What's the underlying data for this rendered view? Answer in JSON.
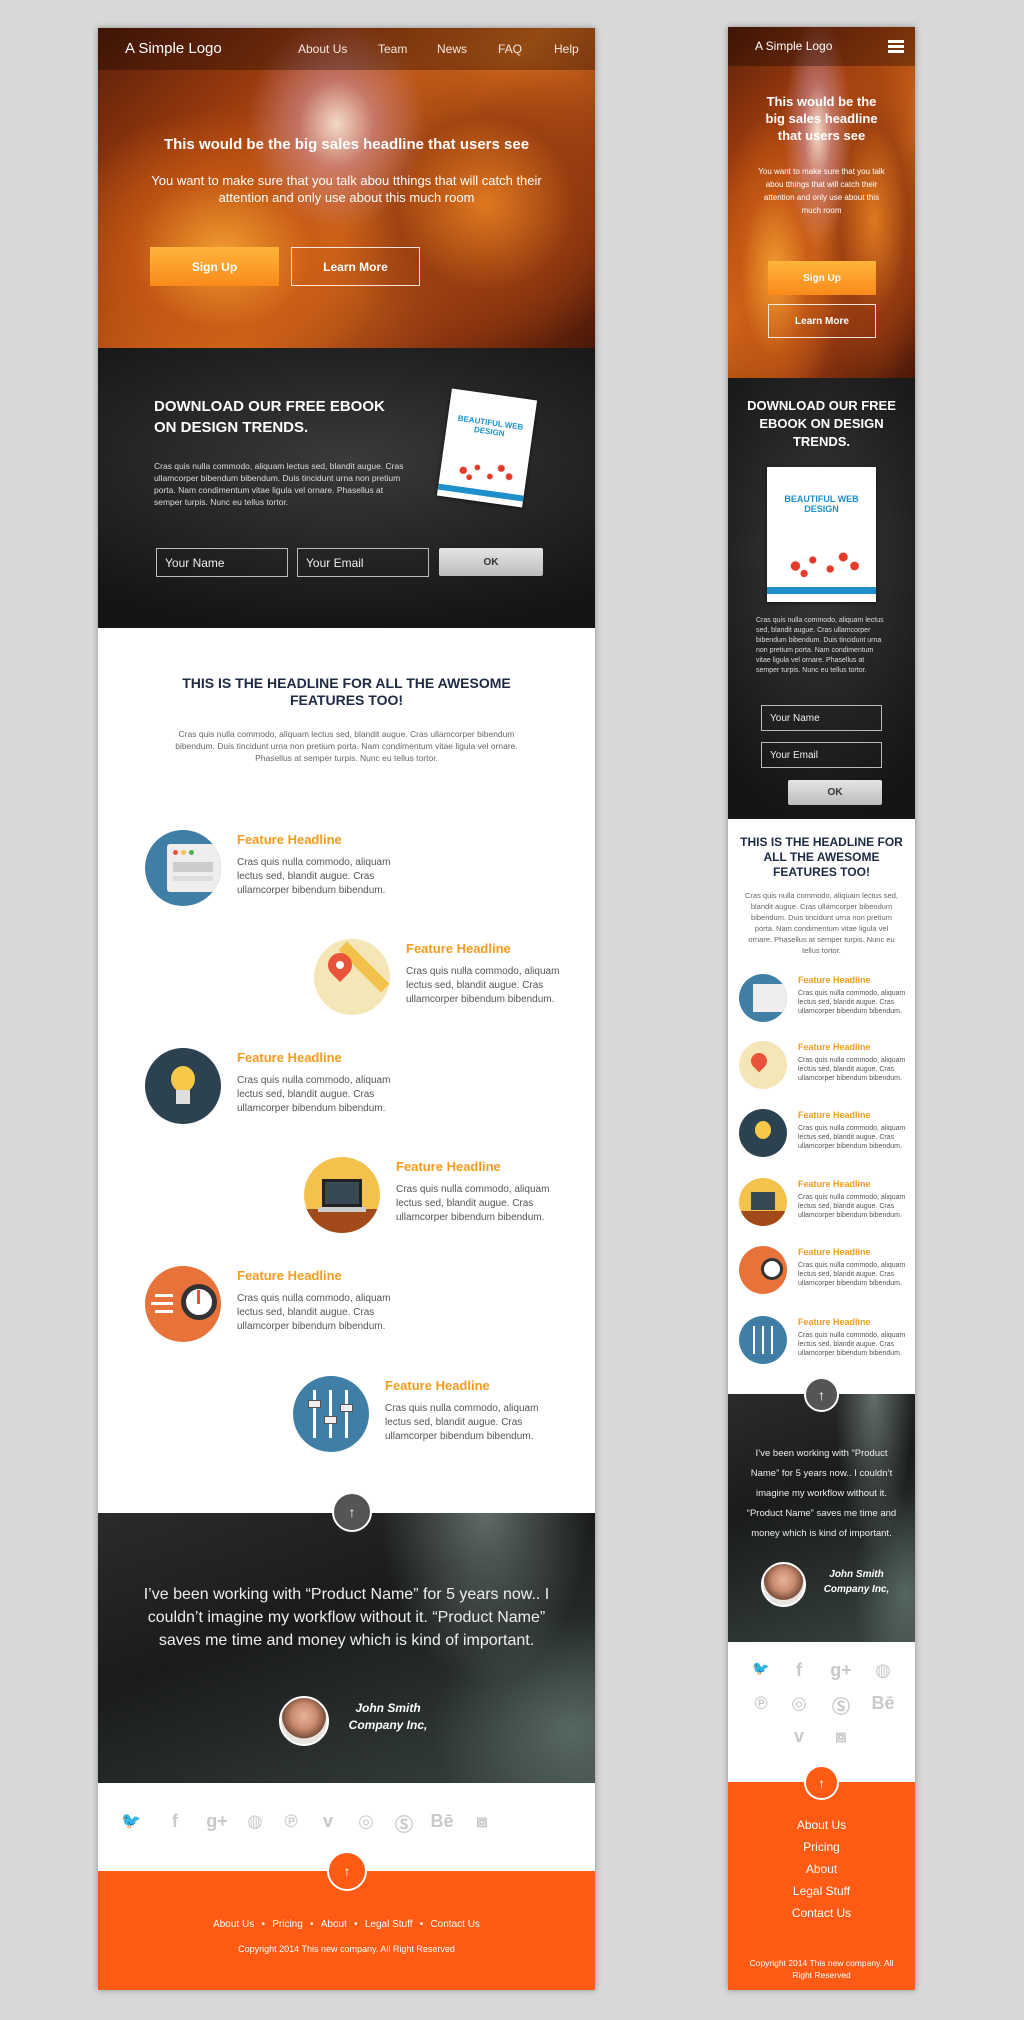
{
  "brand": "A Simple Logo",
  "nav": [
    "About Us",
    "Team",
    "News",
    "FAQ",
    "Help"
  ],
  "hero": {
    "headline": "This would be the big sales headline that users see",
    "subtext": "You want to make sure that you talk abou tthings that will catch their attention and only use about this much room",
    "signup_label": "Sign Up",
    "learn_label": "Learn More"
  },
  "ebook": {
    "headline": "DOWNLOAD OUR FREE EBOOK ON DESIGN TRENDS.",
    "body": "Cras quis nulla commodo, aliquam lectus sed, blandit augue. Cras ullamcorper bibendum bibendum. Duis tincidunt urna non pretium porta. Nam condimentum vitae ligula vel ornare. Phasellus at semper turpis. Nunc eu tellus tortor.",
    "name_placeholder": "Your Name",
    "email_placeholder": "Your Email",
    "ok_label": "OK",
    "cover_title": "BEAUTIFUL WEB DESIGN"
  },
  "features": {
    "headline": "THIS IS THE HEADLINE FOR ALL THE AWESOME FEATURES TOO!",
    "intro": "Cras quis nulla commodo, aliquam lectus sed, blandit augue. Cras ullamcorper bibendum bibendum. Duis tincidunt urna non pretium porta. Nam condimentum vitae ligula vel ornare. Phasellus at semper turpis. Nunc eu tellus tortor.",
    "items": [
      {
        "title": "Feature Headline",
        "body": "Cras quis nulla commodo, aliquam lectus sed, blandit augue. Cras ullamcorper bibendum bibendum.",
        "icon": "browser-window-icon",
        "color": "#3f7fa6"
      },
      {
        "title": "Feature Headline",
        "body": "Cras quis nulla commodo, aliquam lectus sed, blandit augue. Cras ullamcorper bibendum bibendum.",
        "icon": "map-pin-icon",
        "color": "#f5e6b8"
      },
      {
        "title": "Feature Headline",
        "body": "Cras quis nulla commodo, aliquam lectus sed, blandit augue. Cras ullamcorper bibendum bibendum.",
        "icon": "light-bulb-icon",
        "color": "#2c4250"
      },
      {
        "title": "Feature Headline",
        "body": "Cras quis nulla commodo, aliquam lectus sed, blandit augue. Cras ullamcorper bibendum bibendum.",
        "icon": "laptop-icon",
        "color": "#f2c24d"
      },
      {
        "title": "Feature Headline",
        "body": "Cras quis nulla commodo, aliquam lectus sed, blandit augue. Cras ullamcorper bibendum bibendum.",
        "icon": "stopwatch-icon",
        "color": "#e8733a"
      },
      {
        "title": "Feature Headline",
        "body": "Cras quis nulla commodo, aliquam lectus sed, blandit augue. Cras ullamcorper bibendum bibendum.",
        "icon": "sliders-icon",
        "color": "#3f7fa6"
      }
    ]
  },
  "testimonial": {
    "quote": "I’ve been working with “Product Name” for 5 years now.. I couldn’t imagine my workflow without it. “Product Name” saves me time and money which is kind of important.",
    "name": "John Smith",
    "company": "Company Inc,"
  },
  "social": [
    "twitter-icon",
    "facebook-icon",
    "google-plus-icon",
    "github-icon",
    "pinterest-icon",
    "vimeo-icon",
    "dribbble-icon",
    "skype-icon",
    "behance-icon",
    "dropbox-icon"
  ],
  "social_glyphs": {
    "twitter-icon": "🐦",
    "facebook-icon": "f",
    "google-plus-icon": "g+",
    "github-icon": "◍",
    "pinterest-icon": "℗",
    "vimeo-icon": "v",
    "dribbble-icon": "◎",
    "skype-icon": "Ⓢ",
    "behance-icon": "Bē",
    "dropbox-icon": "⧈"
  },
  "footer": {
    "links": [
      "About Us",
      "Pricing",
      "About",
      "Legal Stuff",
      "Contact Us"
    ],
    "copyright": "Copyright 2014 This new company. All Right Reserved"
  },
  "colors": {
    "orange": "#ff5b14",
    "feature_title": "#f39c1f",
    "headline_navy": "#1c2a44"
  }
}
